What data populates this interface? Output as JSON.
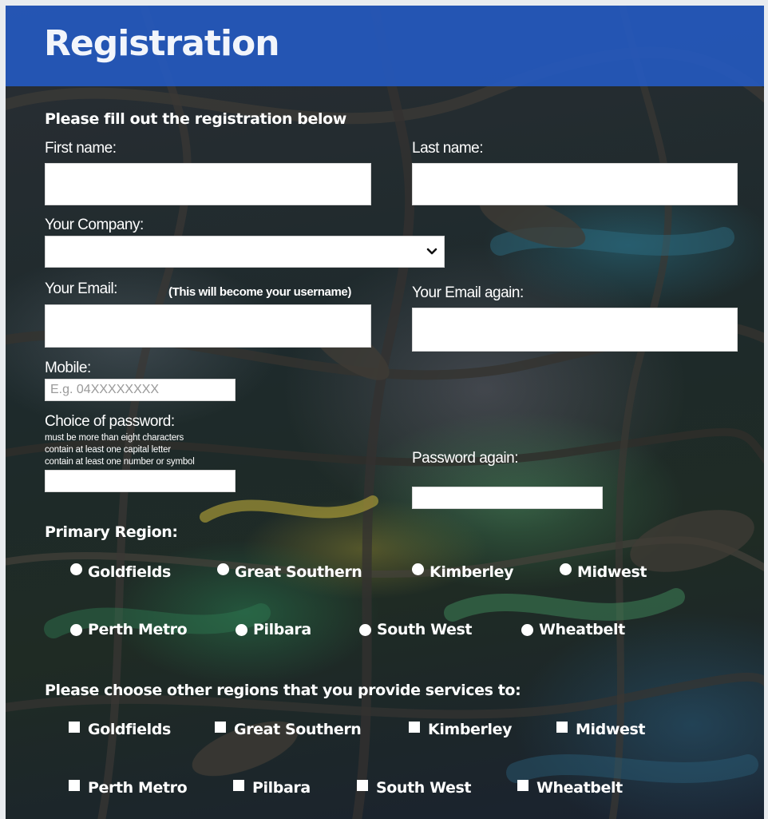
{
  "header": {
    "title": "Registration"
  },
  "form": {
    "intro": "Please fill out the registration below",
    "first_name": {
      "label": "First name:",
      "value": ""
    },
    "last_name": {
      "label": "Last name:",
      "value": ""
    },
    "company": {
      "label": "Your Company:",
      "selected": ""
    },
    "email": {
      "label": "Your Email:",
      "note": "(This will become your username)",
      "value": ""
    },
    "email_again": {
      "label": "Your Email again:",
      "value": ""
    },
    "mobile": {
      "label": "Mobile:",
      "placeholder": "E.g. 04XXXXXXXX",
      "value": ""
    },
    "password": {
      "label": "Choice of password:",
      "rules": [
        "must be more than eight characters",
        "contain at least one capital letter",
        "contain at least one number or symbol"
      ],
      "value": ""
    },
    "password_again": {
      "label": "Password again:",
      "value": ""
    },
    "primary_region": {
      "heading": "Primary Region:",
      "options": [
        "Goldfields",
        "Great Southern",
        "Kimberley",
        "Midwest",
        "Perth Metro",
        "Pilbara",
        "South West",
        "Wheatbelt"
      ],
      "selected": ""
    },
    "other_regions": {
      "heading": "Please choose other regions that you provide services to:",
      "options": [
        "Goldfields",
        "Great Southern",
        "Kimberley",
        "Midwest",
        "Perth Metro",
        "Pilbara",
        "South West",
        "Wheatbelt"
      ],
      "checked": []
    }
  },
  "colors": {
    "header_band": "#245cc8",
    "text": "#ffffff",
    "field": "#ffffff"
  },
  "icons": {
    "select_chevron": "chevron-down-icon"
  }
}
